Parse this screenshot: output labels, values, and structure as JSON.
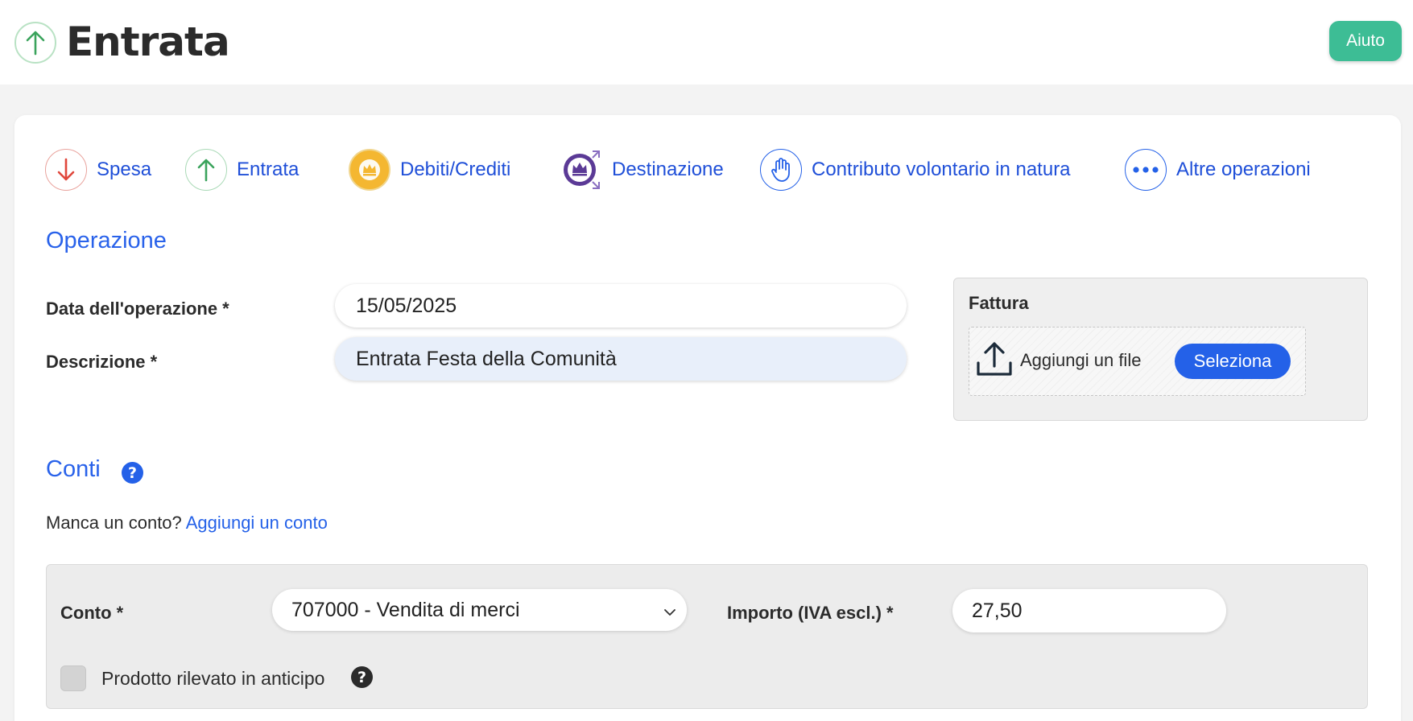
{
  "header": {
    "title": "Entrata",
    "title_icon": "arrow-up-icon",
    "help_label": "Aiuto"
  },
  "colors": {
    "accent": "#2461e8",
    "help_button": "#3dbd95",
    "entrata": "#3aa35c",
    "spesa": "#e0473c",
    "debiti": "#f4b731",
    "destinazione": "#5b3a96"
  },
  "operations": [
    {
      "label": "Spesa",
      "icon": "arrow-down-icon"
    },
    {
      "label": "Entrata",
      "icon": "arrow-up-icon"
    },
    {
      "label": "Debiti/Crediti",
      "icon": "crown-icon"
    },
    {
      "label": "Destinazione",
      "icon": "crown-arrows-icon"
    },
    {
      "label": "Contributo volontario in natura",
      "icon": "hand-icon"
    },
    {
      "label": "Altre operazioni",
      "icon": "more-dots-icon"
    }
  ],
  "operazione": {
    "section_title": "Operazione",
    "date_label": "Data dell'operazione *",
    "date_value": "15/05/2025",
    "description_label": "Descrizione *",
    "description_value": "Entrata Festa della Comunità",
    "invoice": {
      "label": "Fattura",
      "add_file_text": "Aggiungi un file",
      "select_button": "Seleziona",
      "icon": "upload-icon"
    }
  },
  "conti": {
    "section_title": "Conti",
    "missing_text": "Manca un conto?",
    "add_link": "Aggiungi un conto",
    "account_label": "Conto *",
    "account_value": "707000 - Vendita di merci",
    "amount_label": "Importo (IVA escl.) *",
    "amount_value": "27,50",
    "advance_label": "Prodotto rilevato in anticipo",
    "help_icon": "question-icon"
  }
}
